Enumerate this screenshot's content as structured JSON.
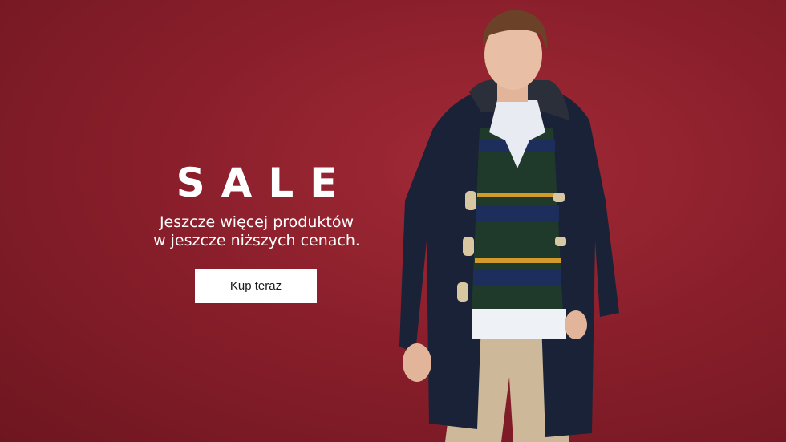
{
  "promo": {
    "title": "SALE",
    "subtitle_line1": "Jeszcze więcej produktów",
    "subtitle_line2": "w jeszcze niższych cenach.",
    "cta_label": "Kup teraz"
  },
  "colors": {
    "background": "#8a1f2b",
    "text": "#ffffff",
    "button_bg": "#ffffff",
    "button_text": "#1a1a1a"
  },
  "image": {
    "subject": "model-in-navy-duffle-coat"
  }
}
